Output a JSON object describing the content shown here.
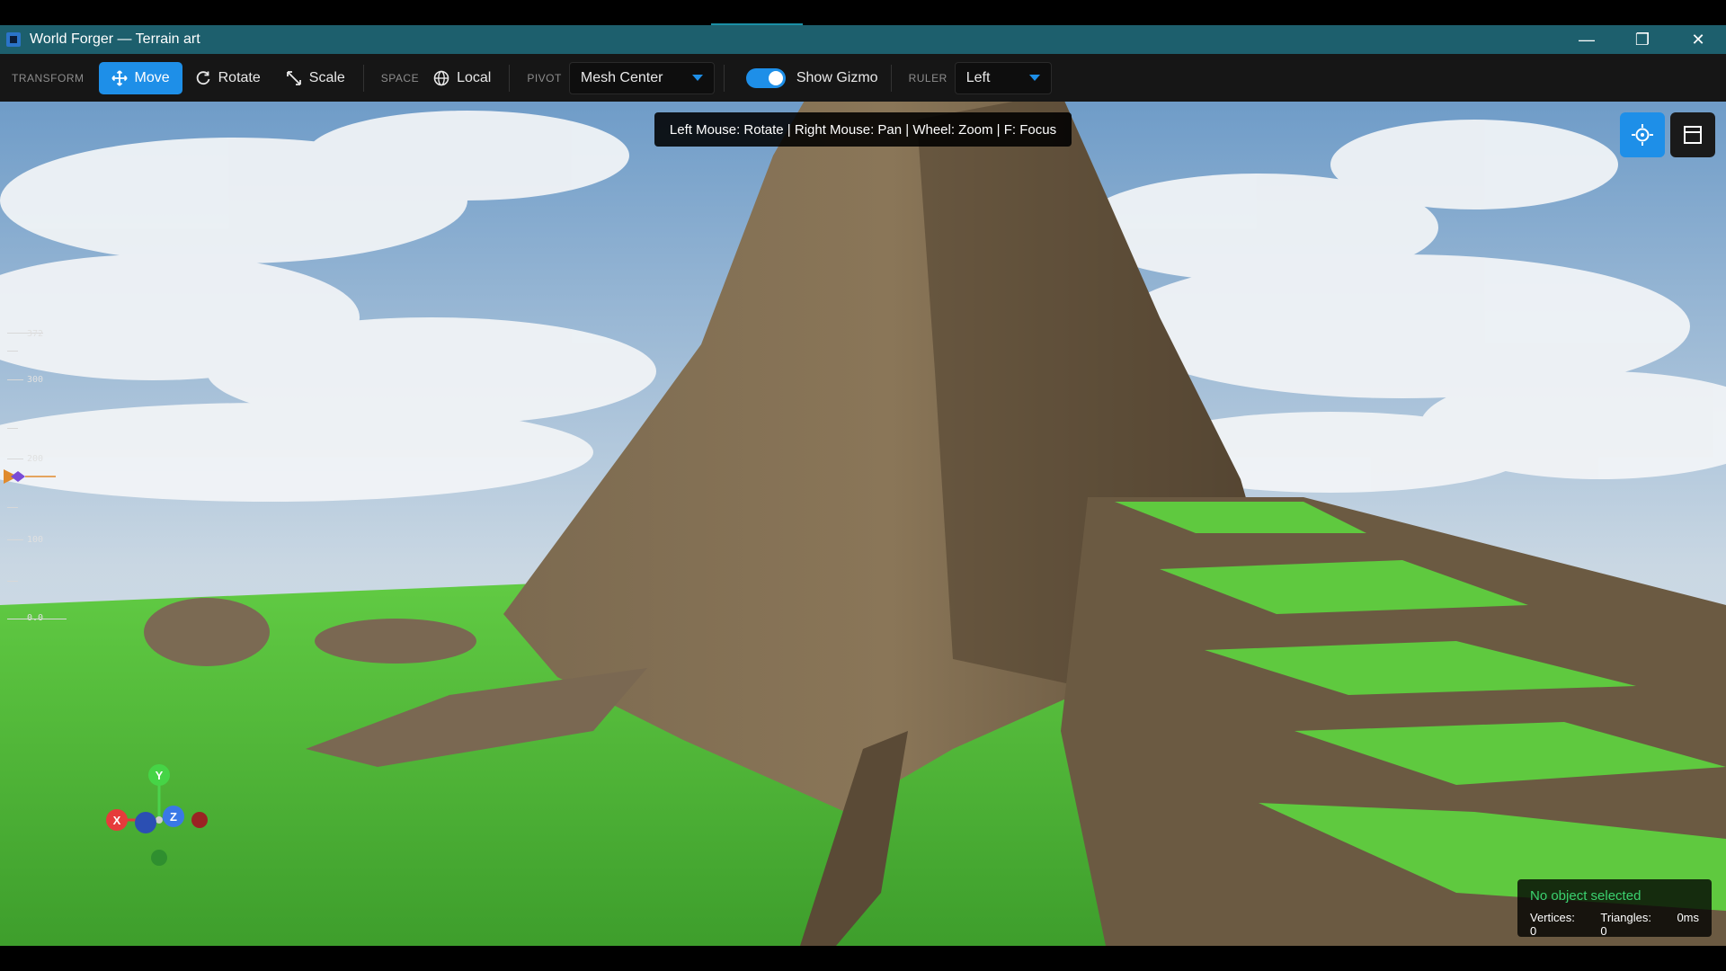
{
  "window": {
    "title": "World Forger — Terrain art",
    "controls": {
      "minimize": "—",
      "restore": "❐",
      "close": "✕"
    }
  },
  "toolbar": {
    "transform_label": "TRANSFORM",
    "move_label": "Move",
    "rotate_label": "Rotate",
    "scale_label": "Scale",
    "space_label": "SPACE",
    "space_value": "Local",
    "pivot_label": "PIVOT",
    "pivot_value": "Mesh Center",
    "show_gizmo_label": "Show Gizmo",
    "show_gizmo_on": true,
    "ruler_label": "RULER",
    "ruler_value": "Left"
  },
  "viewport": {
    "hint": "Left Mouse: Rotate | Right Mouse: Pan | Wheel: Zoom | F: Focus",
    "ruler_labels": [
      "372",
      "300",
      "200",
      "100",
      "0.0"
    ],
    "gizmo": {
      "y": "Y",
      "x": "X",
      "z": "Z"
    }
  },
  "status": {
    "selection": "No object selected",
    "vertices": "Vertices: 0",
    "triangles": "Triangles: 0",
    "time": "0ms"
  },
  "colors": {
    "accent": "#1e8fe8",
    "titlebar": "#1d5f6d",
    "status_ok": "#3bd16f",
    "grass": "#4fbf3a",
    "rock": "#6e5d45",
    "sky": "#7fa8cf"
  }
}
